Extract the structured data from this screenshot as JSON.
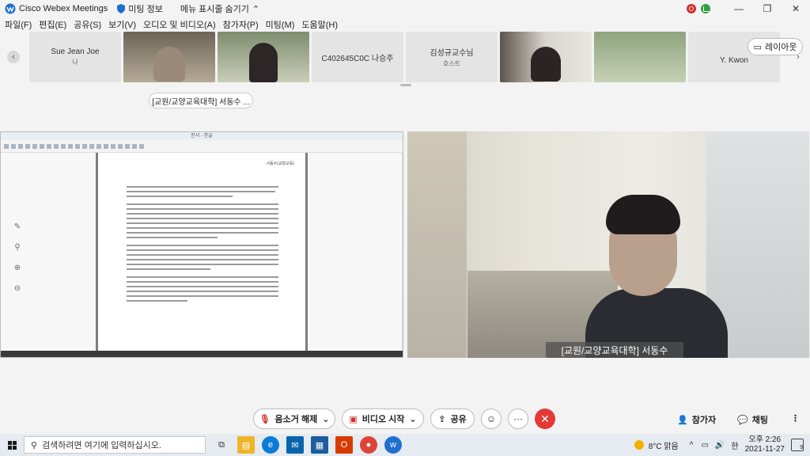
{
  "titlebar": {
    "app_title": "Cisco Webex Meetings",
    "meeting_info": "미팅 정보",
    "hide_menu": "메뉴 표시줄 숨기기",
    "status_initial": "O"
  },
  "menu": [
    "파일(F)",
    "편집(E)",
    "공유(S)",
    "보기(V)",
    "오디오 및 비디오(A)",
    "참가자(P)",
    "미팅(M)",
    "도움말(H)"
  ],
  "participants": [
    {
      "name": "Sue Jean Joe",
      "role": "나",
      "video": false
    },
    {
      "name": "",
      "role": "",
      "video": true
    },
    {
      "name": "",
      "role": "",
      "video": true
    },
    {
      "name": "C402645C0C 나승주",
      "role": "",
      "video": false
    },
    {
      "name": "김성규교수님",
      "role": "호스트",
      "video": false
    },
    {
      "name": "",
      "role": "",
      "video": true
    },
    {
      "name": "",
      "role": "",
      "video": true
    },
    {
      "name": "Y. Kwon",
      "role": "",
      "video": false
    }
  ],
  "layout_button": "레이아웃",
  "active_speaker_pill": "[교원/교양교육대학] 서동수 ...",
  "shared_doc": {
    "window_title": "문서 - 한글",
    "page_header": "서동수(교양교육)"
  },
  "video_name_label": "[교원/교양교육대학] 서동수",
  "controls": {
    "unmute": "음소거 해제",
    "start_video": "비디오 시작",
    "share": "공유",
    "more": "···",
    "end": "✕",
    "participants": "참가자",
    "chat": "채팅"
  },
  "taskbar": {
    "search_placeholder": "검색하려면 여기에 입력하십시오.",
    "weather": "8°C 맑음",
    "ime": "한",
    "time": "오후 2:26",
    "date": "2021-11-27",
    "notification_count": "9"
  },
  "colors": {
    "accent_red": "#e53935",
    "webex_blue": "#1f6fd1",
    "status_green": "#2e9e44"
  }
}
